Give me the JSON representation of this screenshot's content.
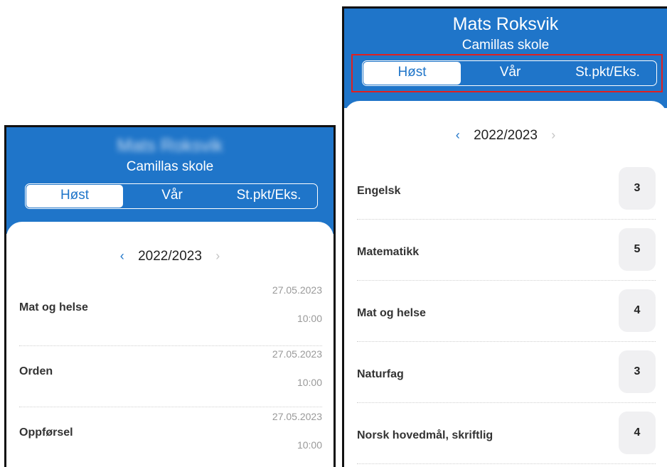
{
  "left_panel": {
    "student_name": "Mats Roksvik",
    "school": "Camillas skole",
    "tabs": [
      "Høst",
      "Vår",
      "St.pkt/Eks."
    ],
    "active_tab": "Høst",
    "year_nav": {
      "prev_icon": "‹",
      "year": "2022/2023",
      "next_icon": "›"
    },
    "rows": [
      {
        "subject": "Mat og helse",
        "date": "27.05.2023",
        "time": "10:00"
      },
      {
        "subject": "Orden",
        "date": "27.05.2023",
        "time": "10:00"
      },
      {
        "subject": "Oppførsel",
        "date": "27.05.2023",
        "time": "10:00"
      }
    ]
  },
  "right_panel": {
    "student_name": "Mats Roksvik",
    "school": "Camillas skole",
    "tabs": [
      "Høst",
      "Vår",
      "St.pkt/Eks."
    ],
    "active_tab": "Høst",
    "year_nav": {
      "prev_icon": "‹",
      "year": "2022/2023",
      "next_icon": "›"
    },
    "rows": [
      {
        "subject": "Engelsk",
        "grade": "3"
      },
      {
        "subject": "Matematikk",
        "grade": "5"
      },
      {
        "subject": "Mat og helse",
        "grade": "4"
      },
      {
        "subject": "Naturfag",
        "grade": "3"
      },
      {
        "subject": "Norsk hovedmål, skriftlig",
        "grade": "4"
      }
    ]
  },
  "colors": {
    "header_blue": "#1f75c9",
    "highlight_red": "#e02020",
    "grade_bg": "#f0f0f2"
  }
}
